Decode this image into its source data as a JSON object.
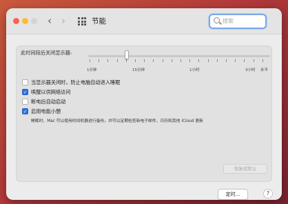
{
  "window": {
    "title": "节能",
    "nav_back": "‹",
    "nav_forward": "›"
  },
  "search": {
    "placeholder": "搜索"
  },
  "slider": {
    "label": "此时间段后关闭显示器:",
    "ticks": [
      "1分钟",
      "15分钟",
      "1小时",
      "3小时",
      "永不"
    ]
  },
  "options": {
    "opt1": {
      "label": "当显示器关闭时，防止电脑自动进入睡眠",
      "checked": false
    },
    "opt2": {
      "label": "唤醒以供网络访问",
      "checked": true
    },
    "opt3": {
      "label": "断电后自动启动",
      "checked": false
    },
    "opt4": {
      "label": "启用电能小憩",
      "checked": true
    }
  },
  "power_nap_desc": "睡眠时，Mac 可以使用时间机器进行备份，并可以定期检查新电子邮件、日历和其他 iCloud 更新",
  "buttons": {
    "restore_defaults": "恢复成默认",
    "schedule": "定时...",
    "help": "?"
  },
  "colors": {
    "accent": "#2f6fde",
    "close": "#fe5f57",
    "minimize": "#febc2e",
    "zoom": "#d4d4d4"
  }
}
